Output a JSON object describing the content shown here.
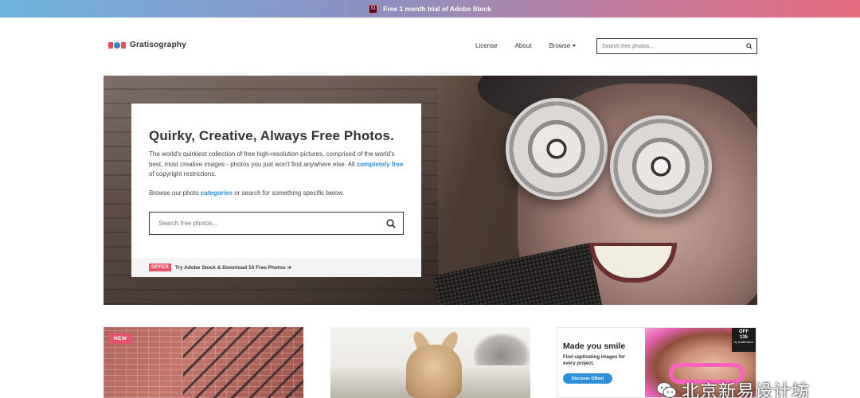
{
  "promo": {
    "logo_text": "St",
    "text": "Free 1 month trial of Adobe Stock"
  },
  "header": {
    "brand": "Gratisography",
    "nav": {
      "license": "License",
      "about": "About",
      "browse": "Browse"
    },
    "search_placeholder": "Search free photos..."
  },
  "hero": {
    "title": "Quirky, Creative, Always Free Photos.",
    "desc_part1": "The world's quirkiest collection of free high-resolution pictures, comprised of the world's best, most creative images - photos you just won't find anywhere else. All ",
    "desc_link": "completely free",
    "desc_part2": " of copyright restrictions.",
    "browse_part1": "Browse our photo ",
    "browse_link": "categories",
    "browse_part2": " or search for something specific below.",
    "search_placeholder": "Search free photos...",
    "offer_badge": "OFFER",
    "offer_text": "Try Adobe Stock & Download 10 Free Photos ➔"
  },
  "cards": {
    "new_badge": "NEW",
    "ad": {
      "title": "Made you smile",
      "subtitle": "Find captivating images for every project.",
      "button": "Discover Offset",
      "offer_line1": "OFF",
      "offer_line2": "135",
      "offer_small": "by shutterstock"
    }
  },
  "watermark": "北京新易设计坊"
}
